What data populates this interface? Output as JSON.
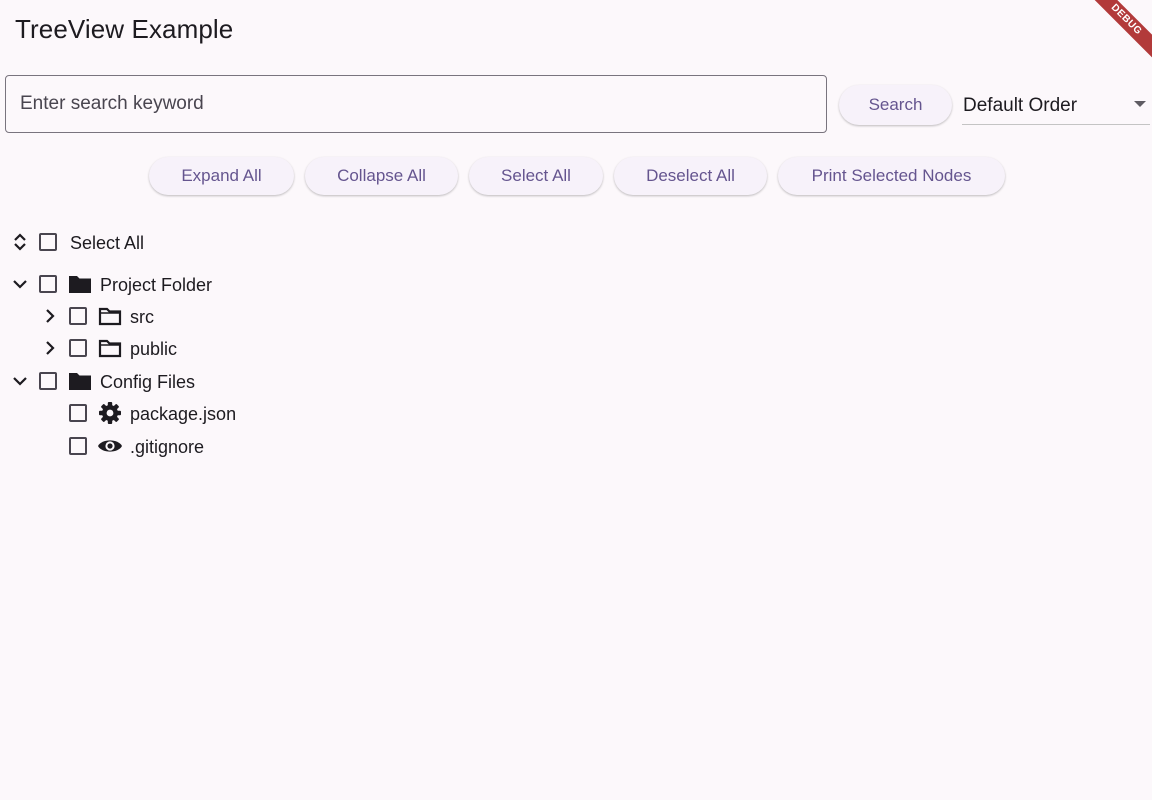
{
  "app": {
    "title": "TreeView Example",
    "debug_label": "DEBUG"
  },
  "search": {
    "placeholder": "Enter search keyword",
    "value": "",
    "button_label": "Search"
  },
  "order": {
    "selected": "Default Order"
  },
  "actions": {
    "expand_all": "Expand All",
    "collapse_all": "Collapse All",
    "select_all": "Select All",
    "deselect_all": "Deselect All",
    "print_selected": "Print Selected Nodes"
  },
  "tree": {
    "select_all_label": "Select All",
    "nodes": [
      {
        "label": "Project Folder",
        "icon": "folder-filled-icon",
        "expanded": true,
        "checked": false
      },
      {
        "label": "src",
        "icon": "folder-outline-icon",
        "expanded": false,
        "checked": false
      },
      {
        "label": "public",
        "icon": "folder-outline-icon",
        "expanded": false,
        "checked": false
      },
      {
        "label": "Config Files",
        "icon": "folder-filled-icon",
        "expanded": true,
        "checked": false
      },
      {
        "label": "package.json",
        "icon": "gear-icon",
        "checked": false
      },
      {
        "label": ".gitignore",
        "icon": "eye-icon",
        "checked": false
      }
    ]
  },
  "colors": {
    "background": "#fcf8fb",
    "accent": "#65558f",
    "button_bg": "#f7f2fa",
    "debug_banner": "#b23a3a"
  }
}
